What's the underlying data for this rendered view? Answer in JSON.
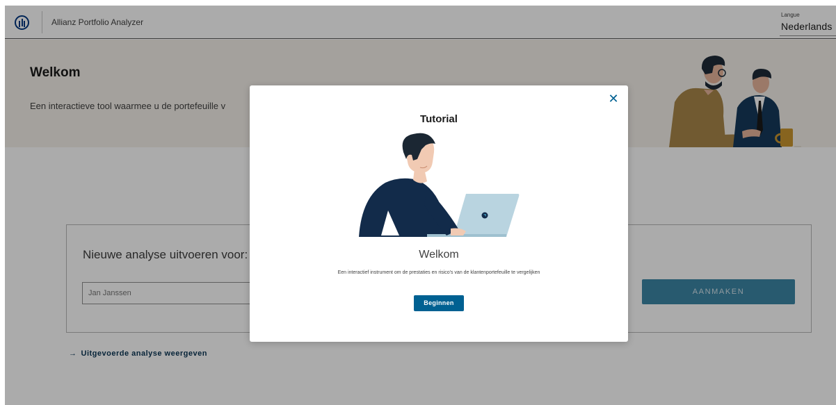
{
  "header": {
    "app_title": "Allianz Portfolio Analyzer",
    "language_caption": "Langue",
    "language_value": "Nederlands"
  },
  "hero": {
    "title": "Welkom",
    "subtitle": "Een interactieve tool waarmee u de portefeuille v"
  },
  "analysis": {
    "title": "Nieuwe analyse uitvoeren voor:",
    "name_placeholder": "Jan Janssen",
    "create_label": "AANMAKEN"
  },
  "view_link": {
    "arrow": "→",
    "label": "Uitgevoerde analyse weergeven"
  },
  "modal": {
    "title": "Tutorial",
    "close_glyph": "✕",
    "heading": "Welkom",
    "text": "Een interactief instrument om de prestaties en risico's van de klantenportefeuille te vergelijken",
    "start_label": "Beginnen"
  },
  "colors": {
    "brand_blue": "#003781",
    "primary_button": "#006192",
    "disabled_button": "#3c86a6",
    "hero_background": "#f5f1ea",
    "overlay": "rgba(0,0,0,0.33)"
  },
  "icons": {
    "logo": "allianz-logo-icon",
    "close": "close-icon",
    "link_arrow": "arrow-right-icon"
  }
}
